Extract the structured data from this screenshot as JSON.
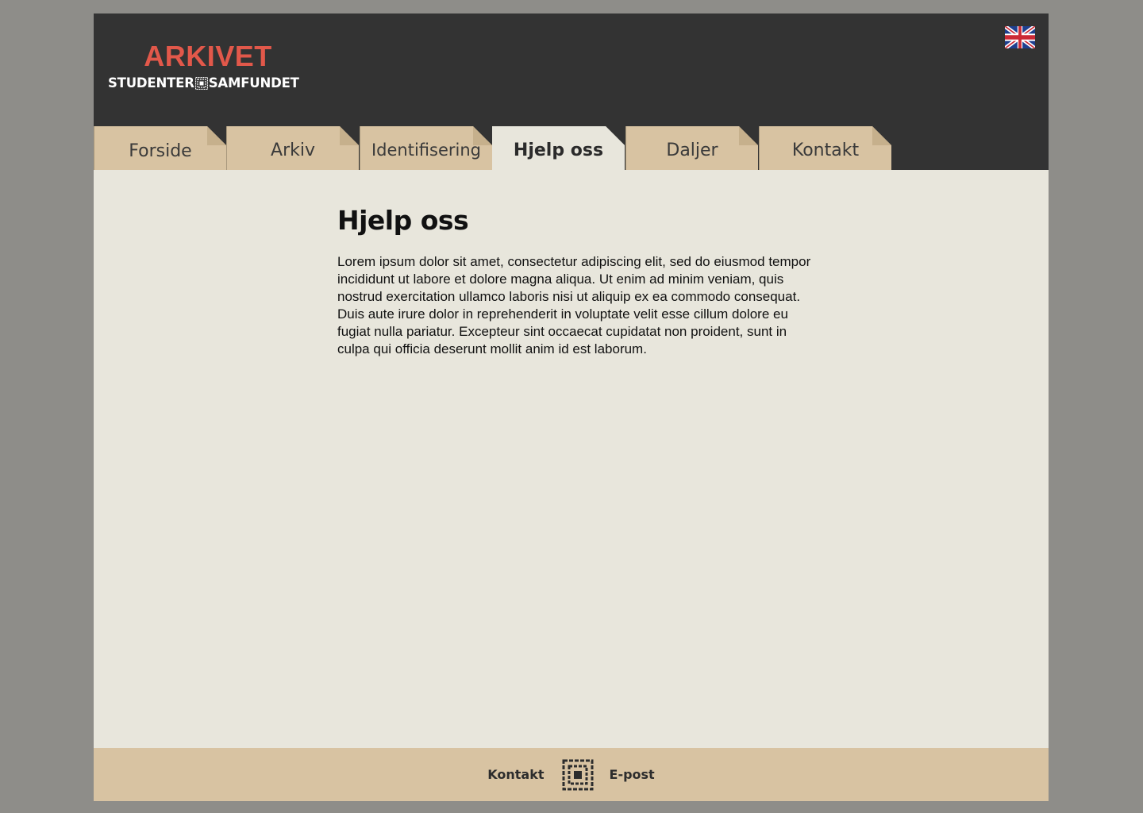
{
  "header": {
    "logo_title": "ARKIVET",
    "logo_left": "STUDENTER",
    "logo_right": "SAMFUNDET",
    "language_flag": "uk-flag-icon"
  },
  "nav": {
    "tabs": [
      {
        "label": "Forside",
        "active": false
      },
      {
        "label": "Arkiv",
        "active": false
      },
      {
        "label": "Identifisering",
        "active": false
      },
      {
        "label": "Hjelp oss",
        "active": true
      },
      {
        "label": "Daljer",
        "active": false
      },
      {
        "label": "Kontakt",
        "active": false
      }
    ]
  },
  "main": {
    "title": "Hjelp oss",
    "body": "Lorem ipsum dolor sit amet, consectetur adipiscing elit, sed do eiusmod tempor incididunt ut labore et dolore magna aliqua. Ut enim ad minim veniam, quis nostrud exercitation ullamco laboris nisi ut aliquip ex ea commodo consequat. Duis aute irure dolor in reprehenderit in voluptate velit esse cillum dolore eu fugiat nulla pariatur. Excepteur sint occaecat cupidatat non proident, sunt in culpa qui officia deserunt mollit anim id est laborum."
  },
  "footer": {
    "contact_label": "Kontakt",
    "email_label": "E-post",
    "center_icon": "samfundet-emblem-icon"
  },
  "colors": {
    "page_bg": "#8e8d89",
    "header_bg": "#333333",
    "brand_red": "#e2584a",
    "tab_bg": "#d8c3a2",
    "content_bg": "#e8e6dc"
  }
}
